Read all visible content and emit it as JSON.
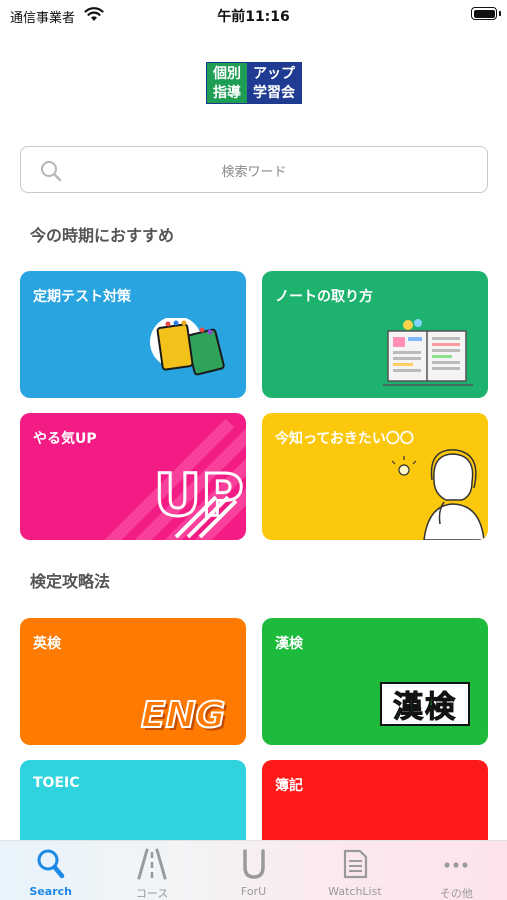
{
  "status_bar": {
    "carrier": "通信事業者",
    "time": "午前11:16"
  },
  "logo": {
    "left_text": "個別指導",
    "right_text": "アップ学習会",
    "left_line1": "個別",
    "left_line2": "指導",
    "right_line1": "アップ",
    "right_line2": "学習会"
  },
  "search": {
    "placeholder": "検索ワード"
  },
  "sections": [
    {
      "title": "今の時期におすすめ",
      "cards": [
        {
          "label": "定期テスト対策",
          "color": "#29a4e0"
        },
        {
          "label": "ノートの取り方",
          "color": "#1db36f"
        },
        {
          "label": "やる気UP",
          "color": "#f21c84",
          "art_text": "UP"
        },
        {
          "label": "今知っておきたい〇〇",
          "color": "#fcc80c"
        }
      ]
    },
    {
      "title": "検定攻略法",
      "cards": [
        {
          "label": "英検",
          "color": "#ff7a00",
          "art_text": "ENG"
        },
        {
          "label": "漢検",
          "color": "#1dbb3c",
          "art_text": "漢検"
        },
        {
          "label": "TOEIC",
          "color": "#2fd3de"
        },
        {
          "label": "簿記",
          "color": "#ff1a1a"
        }
      ]
    }
  ],
  "tab_bar": {
    "items": [
      {
        "label": "Search",
        "icon": "magnifier-icon",
        "active": true
      },
      {
        "label": "コース",
        "icon": "road-icon",
        "active": false
      },
      {
        "label": "ForU",
        "icon": "u-icon",
        "active": false
      },
      {
        "label": "WatchList",
        "icon": "document-icon",
        "active": false
      },
      {
        "label": "その他",
        "icon": "more-dots-icon",
        "active": false
      }
    ]
  }
}
